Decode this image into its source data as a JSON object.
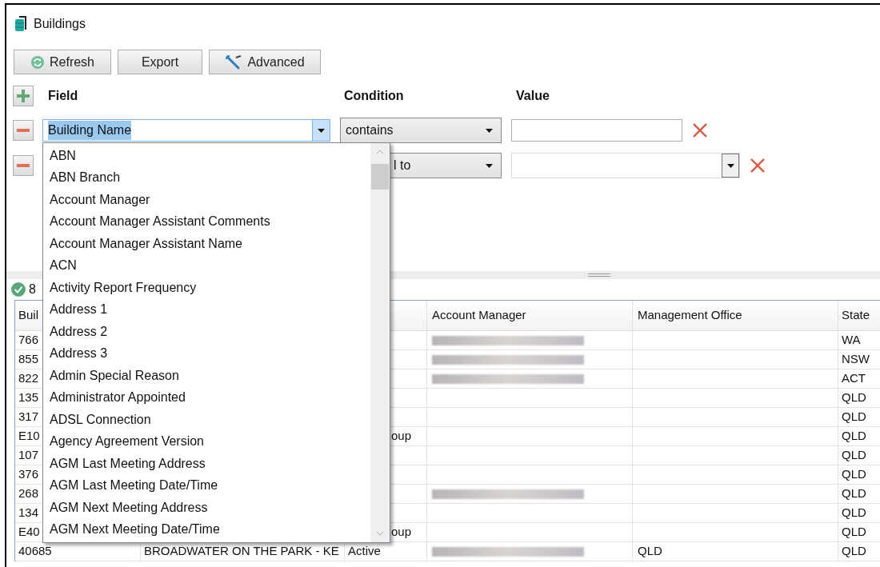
{
  "window": {
    "title": "Buildings"
  },
  "toolbar": [
    "Refresh",
    "Export",
    "Advanced"
  ],
  "filter": {
    "headers": [
      "Field",
      "Condition",
      "Value"
    ],
    "rows": [
      {
        "field": "Building Name",
        "field_text_selected": true,
        "condition": "contains",
        "value_dropdown": false
      },
      {
        "condition": "l to",
        "value_dropdown": true
      }
    ]
  },
  "field_dropdown": {
    "items": [
      "ABN",
      "ABN Branch",
      "Account Manager",
      "Account Manager Assistant Comments",
      "Account Manager Assistant Name",
      "ACN",
      "Activity Report Frequency",
      "Address 1",
      "Address 2",
      "Address 3",
      "Admin Special Reason",
      "Administrator Appointed",
      "ADSL Connection",
      "Agency Agreement Version",
      "AGM Last Meeting Address",
      "AGM Last Meeting Date/Time",
      "AGM Next Meeting Address",
      "AGM Next Meeting Date/Time"
    ]
  },
  "status": {
    "count": "8"
  },
  "table": {
    "columns": [
      "Buil",
      "",
      "",
      "Account Manager",
      "Management Office",
      "State"
    ],
    "rows": [
      {
        "cells": [
          "766",
          "",
          "",
          "",
          "",
          "WA"
        ],
        "manager_redacted": true
      },
      {
        "cells": [
          "855",
          "",
          "",
          "",
          "",
          "NSW"
        ],
        "manager_redacted": true
      },
      {
        "cells": [
          "822",
          "",
          "",
          "",
          "",
          "ACT"
        ],
        "manager_redacted": true
      },
      {
        "cells": [
          "135",
          "",
          "",
          "",
          "",
          "QLD"
        ],
        "manager_redacted": false
      },
      {
        "cells": [
          "317",
          "",
          "",
          "",
          "",
          "QLD"
        ],
        "manager_redacted": false
      },
      {
        "cells": [
          "E10",
          "",
          "oup",
          "",
          "",
          "QLD"
        ],
        "manager_redacted": false
      },
      {
        "cells": [
          "107",
          "",
          "",
          "",
          "",
          "QLD"
        ],
        "manager_redacted": false
      },
      {
        "cells": [
          "376",
          "",
          "",
          "",
          "",
          "QLD"
        ],
        "manager_redacted": false
      },
      {
        "cells": [
          "268",
          "",
          "",
          "",
          "",
          "QLD"
        ],
        "manager_redacted": true
      },
      {
        "cells": [
          "134",
          "",
          "",
          "",
          "",
          "QLD"
        ],
        "manager_redacted": false
      },
      {
        "cells": [
          "E40",
          "",
          "oup",
          "",
          "",
          "QLD"
        ],
        "manager_redacted": false
      },
      {
        "cells": [
          "40685",
          "BROADWATER ON THE PARK - KE",
          "Active",
          "",
          "QLD",
          "QLD"
        ],
        "manager_redacted": true
      }
    ]
  }
}
